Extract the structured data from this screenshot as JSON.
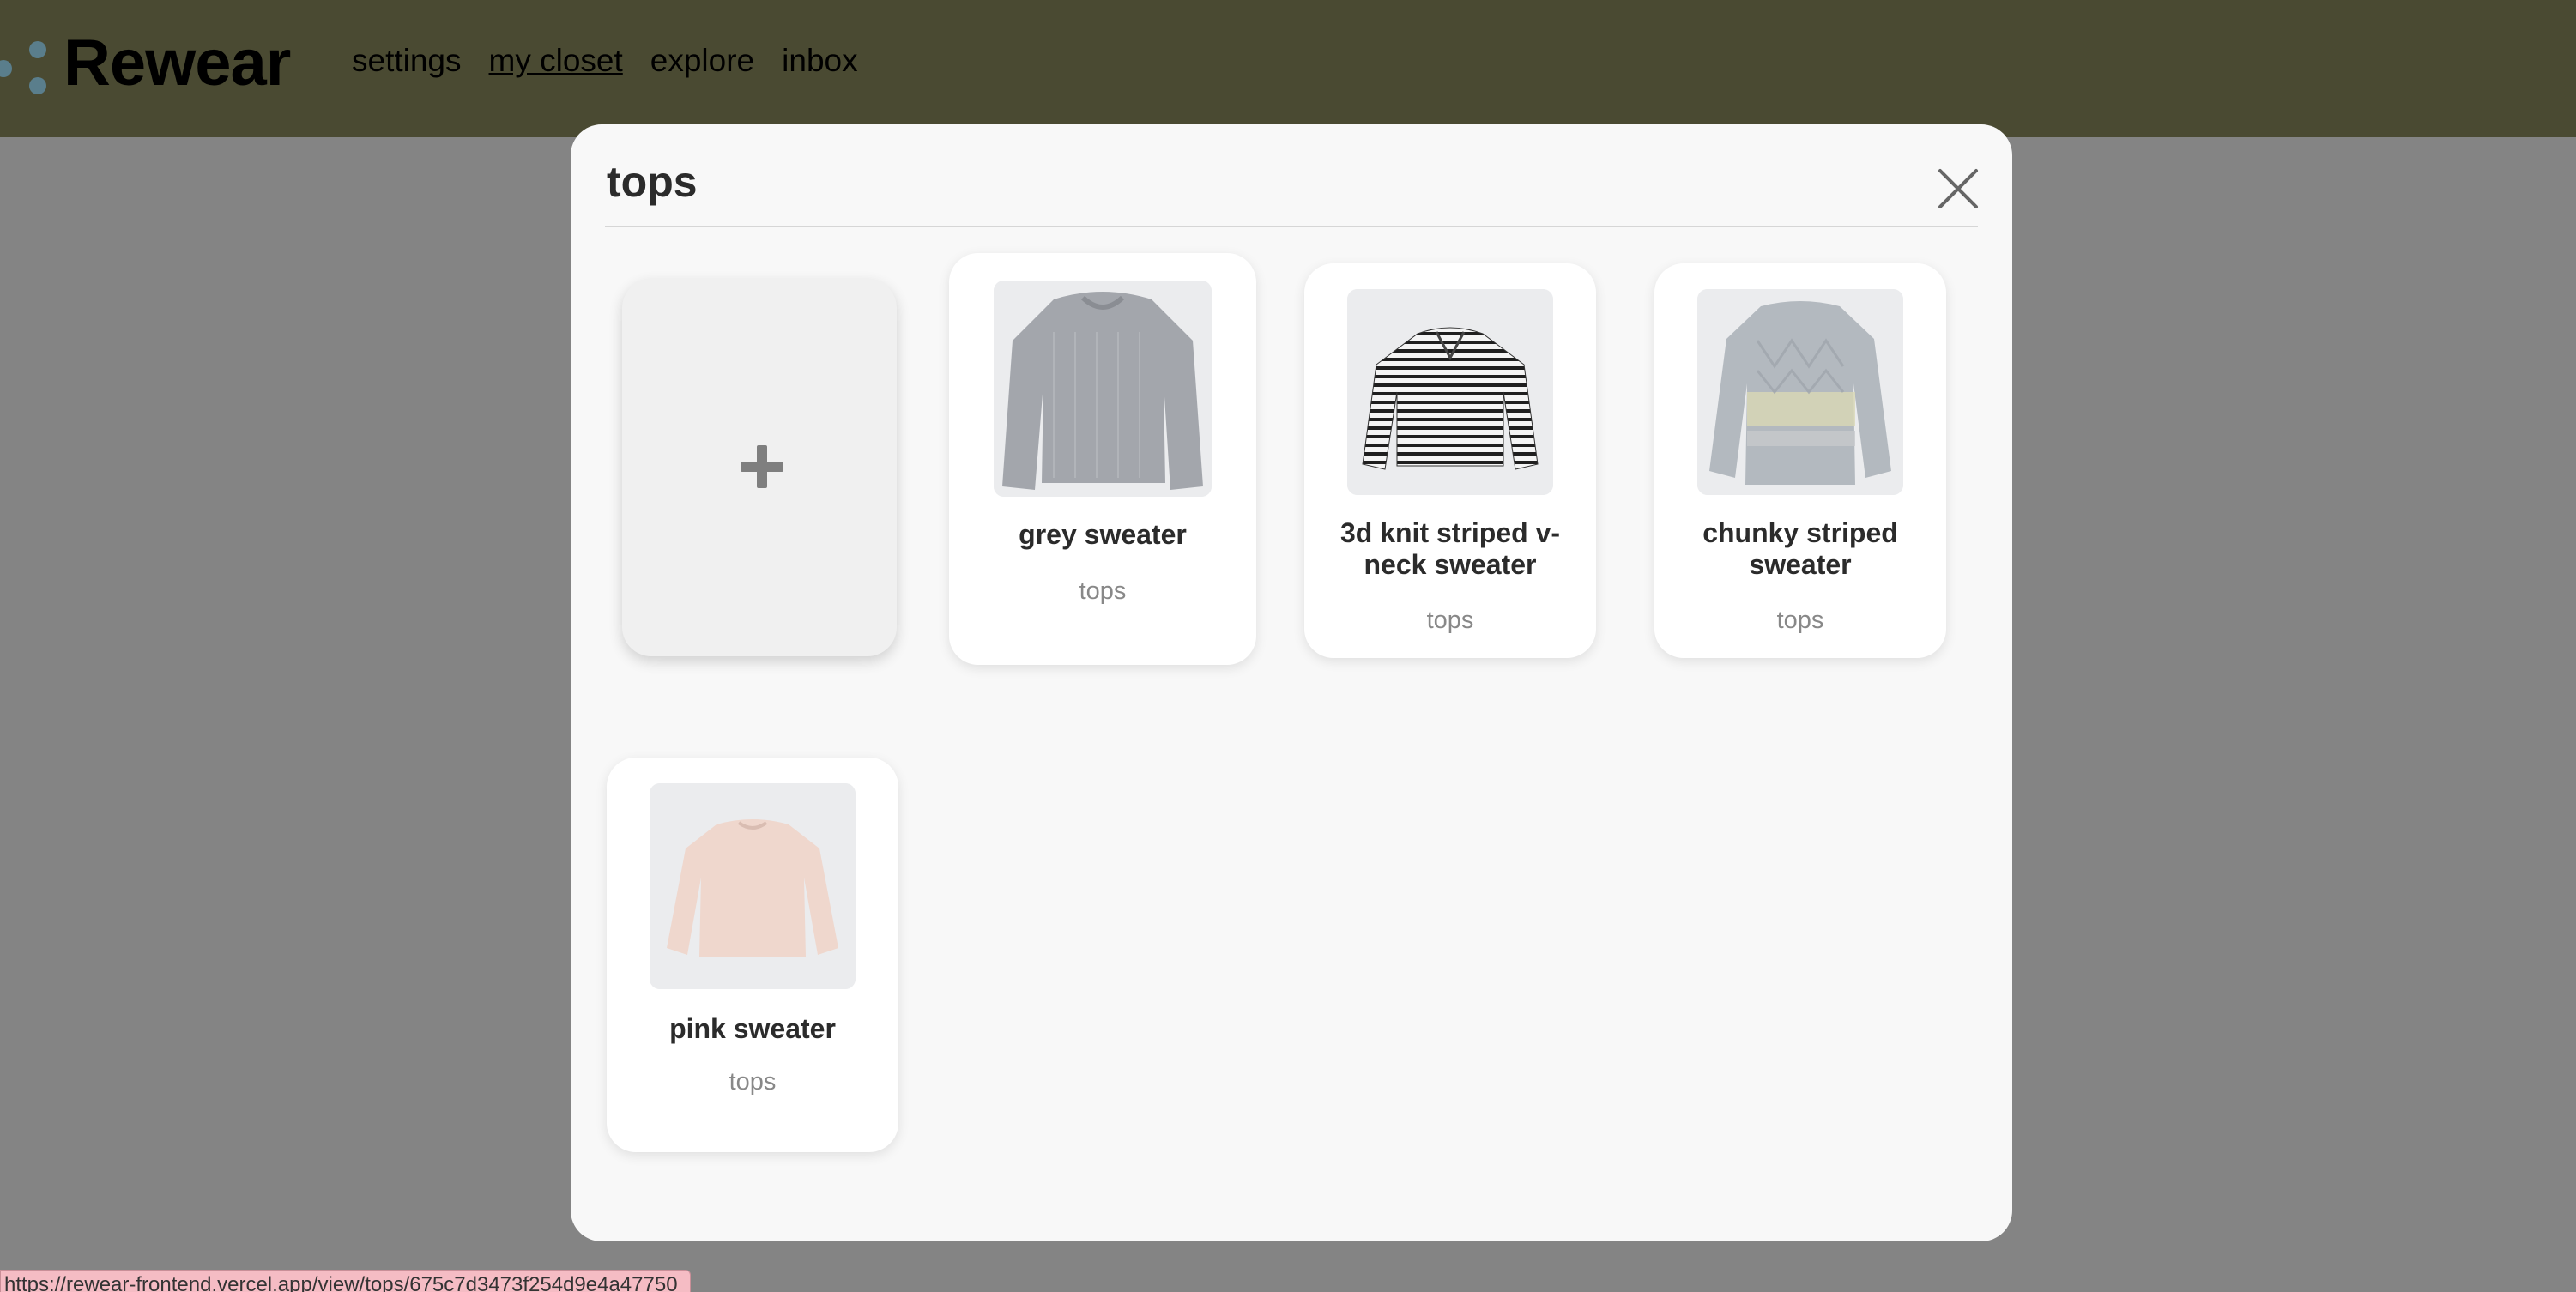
{
  "app": {
    "name": "Rewear",
    "brand_color": "#4a4a32",
    "logo_dot_color": "#5a7e8c"
  },
  "nav": {
    "items": [
      {
        "label": "settings",
        "active": false
      },
      {
        "label": "my closet",
        "active": true
      },
      {
        "label": "explore",
        "active": false
      },
      {
        "label": "inbox",
        "active": false
      }
    ]
  },
  "modal": {
    "title": "tops",
    "close_icon": "close-icon",
    "add_icon": "plus-icon",
    "items": [
      {
        "name": "grey sweater",
        "category": "tops",
        "image": "grey-sweater-image"
      },
      {
        "name": "3d knit striped v-neck sweater",
        "category": "tops",
        "image": "striped-sweater-image"
      },
      {
        "name": "chunky striped sweater",
        "category": "tops",
        "image": "chunky-sweater-image"
      },
      {
        "name": "pink sweater",
        "category": "tops",
        "image": "pink-sweater-image"
      }
    ]
  },
  "status_bar": {
    "url": "https://rewear-frontend.vercel.app/view/tops/675c7d3473f254d9e4a47750"
  }
}
